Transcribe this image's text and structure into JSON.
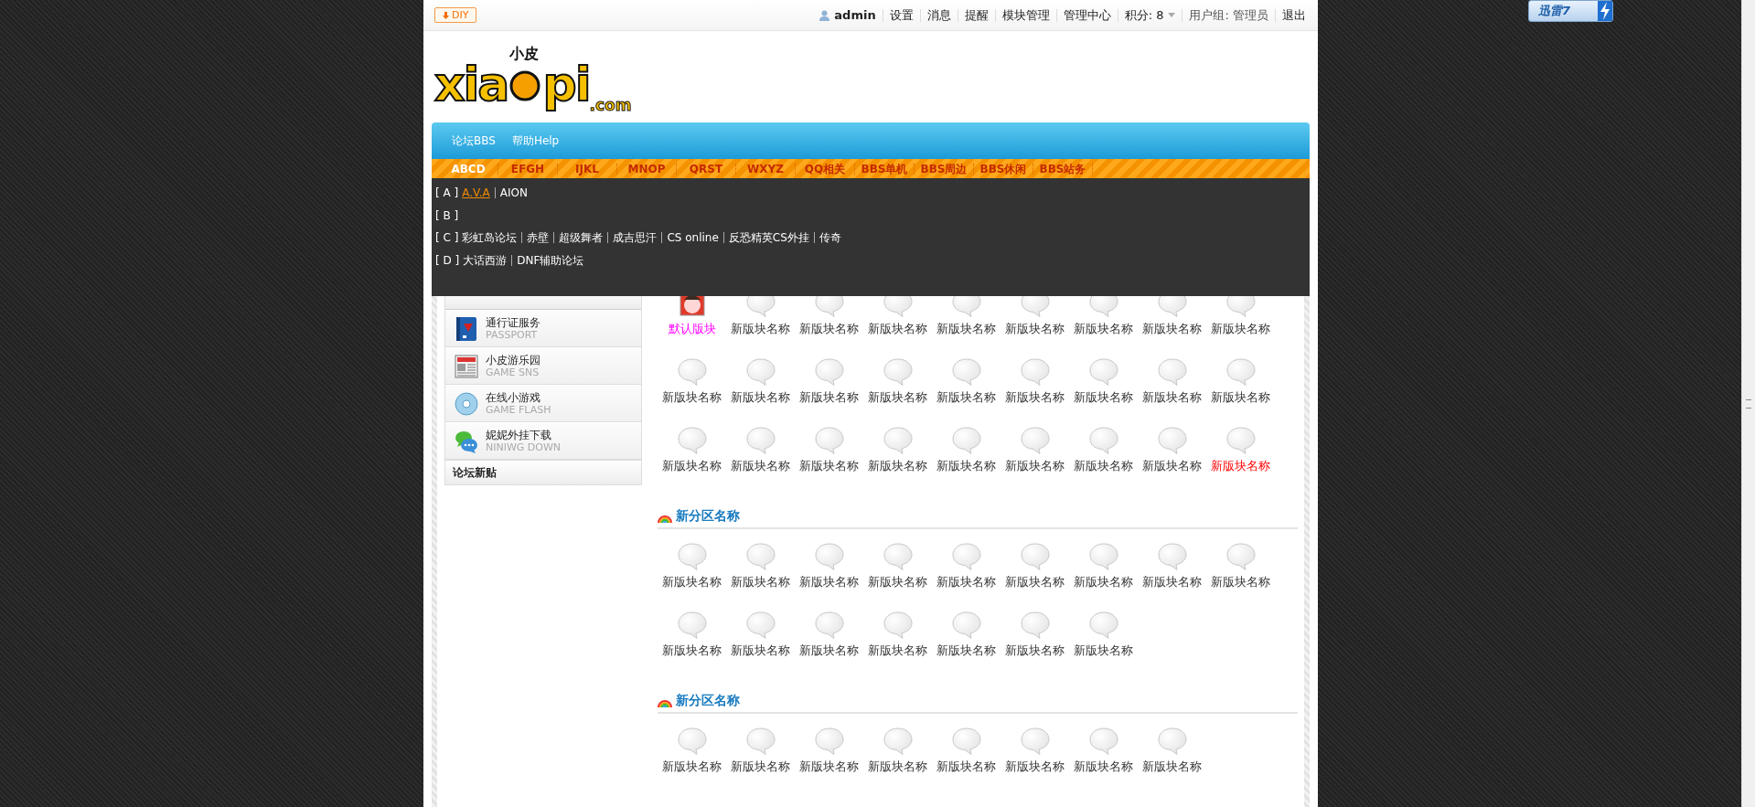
{
  "toolbar": {
    "diy": "DIY",
    "user": "admin",
    "links": [
      "设置",
      "消息",
      "提醒",
      "模块管理",
      "管理中心"
    ],
    "points": "积分: 8",
    "group": "用户组: 管理员",
    "logout": "退出"
  },
  "plugin_button": {
    "label": "迅雷7"
  },
  "logo": {
    "top": "小皮",
    "left": "xia",
    "right": "pi",
    "suffix": ".com"
  },
  "nav": {
    "items": [
      "论坛BBS",
      "帮助Help"
    ]
  },
  "category_tabs": [
    {
      "label": "ABCD",
      "selected": true
    },
    {
      "label": "EFGH",
      "selected": false
    },
    {
      "label": "IJKL",
      "selected": false
    },
    {
      "label": "MNOP",
      "selected": false
    },
    {
      "label": "QRST",
      "selected": false
    },
    {
      "label": "WXYZ",
      "selected": false
    },
    {
      "label": "QQ相关",
      "selected": false
    },
    {
      "label": "BBS单机",
      "selected": false
    },
    {
      "label": "BBS周边",
      "selected": false
    },
    {
      "label": "BBS休闲",
      "selected": false
    },
    {
      "label": "BBS站务",
      "selected": false
    }
  ],
  "dropdown": [
    {
      "letter": "[ A ]",
      "links": [
        {
          "label": "A.V.A",
          "selected": true
        },
        {
          "label": "AION",
          "selected": false
        }
      ]
    },
    {
      "letter": "[ B ]"
    },
    {
      "letter": "[ C ]",
      "links": [
        {
          "label": "彩虹岛论坛",
          "selected": false
        },
        {
          "label": "赤壁",
          "selected": false
        },
        {
          "label": "超级舞者",
          "selected": false
        },
        {
          "label": "成吉思汗",
          "selected": false
        },
        {
          "label": "CS online",
          "selected": false
        },
        {
          "label": "反恐精英CS外挂",
          "selected": false
        },
        {
          "label": "传奇",
          "selected": false
        }
      ]
    },
    {
      "letter": "[ D ]",
      "links": [
        {
          "label": "大话西游",
          "selected": false
        },
        {
          "label": "DNF辅助论坛",
          "selected": false
        }
      ]
    }
  ],
  "sidebar": {
    "items": [
      {
        "kind": "book",
        "title": "通行证服务",
        "subtitle": "PASSPORT"
      },
      {
        "kind": "news",
        "title": "小皮游乐园",
        "subtitle": "GAME SNS"
      },
      {
        "kind": "disc",
        "title": "在线小游戏",
        "subtitle": "GAME FLASH"
      },
      {
        "kind": "chat",
        "title": "妮妮外挂下载",
        "subtitle": "NINIWG DOWN"
      }
    ],
    "footer": "论坛新贴"
  },
  "sections": [
    {
      "forums": [
        {
          "name": "默认版块",
          "kind": "avatar",
          "color": "#ff00ff"
        },
        {
          "name": "新版块名称",
          "kind": "bubble"
        },
        {
          "name": "新版块名称",
          "kind": "bubble"
        },
        {
          "name": "新版块名称",
          "kind": "bubble"
        },
        {
          "name": "新版块名称",
          "kind": "bubble"
        },
        {
          "name": "新版块名称",
          "kind": "bubble"
        },
        {
          "name": "新版块名称",
          "kind": "bubble"
        },
        {
          "name": "新版块名称",
          "kind": "bubble"
        },
        {
          "name": "新版块名称",
          "kind": "bubble"
        },
        {
          "name": "新版块名称",
          "kind": "bubble"
        },
        {
          "name": "新版块名称",
          "kind": "bubble"
        },
        {
          "name": "新版块名称",
          "kind": "bubble"
        },
        {
          "name": "新版块名称",
          "kind": "bubble"
        },
        {
          "name": "新版块名称",
          "kind": "bubble"
        },
        {
          "name": "新版块名称",
          "kind": "bubble"
        },
        {
          "name": "新版块名称",
          "kind": "bubble"
        },
        {
          "name": "新版块名称",
          "kind": "bubble"
        },
        {
          "name": "新版块名称",
          "kind": "bubble"
        },
        {
          "name": "新版块名称",
          "kind": "bubble"
        },
        {
          "name": "新版块名称",
          "kind": "bubble"
        },
        {
          "name": "新版块名称",
          "kind": "bubble"
        },
        {
          "name": "新版块名称",
          "kind": "bubble"
        },
        {
          "name": "新版块名称",
          "kind": "bubble"
        },
        {
          "name": "新版块名称",
          "kind": "bubble"
        },
        {
          "name": "新版块名称",
          "kind": "bubble"
        },
        {
          "name": "新版块名称",
          "kind": "bubble"
        },
        {
          "name": "新版块名称",
          "kind": "bubble",
          "color": "#ff0000"
        }
      ]
    },
    {
      "title": "新分区名称",
      "forums": [
        {
          "name": "新版块名称",
          "kind": "bubble"
        },
        {
          "name": "新版块名称",
          "kind": "bubble"
        },
        {
          "name": "新版块名称",
          "kind": "bubble"
        },
        {
          "name": "新版块名称",
          "kind": "bubble"
        },
        {
          "name": "新版块名称",
          "kind": "bubble"
        },
        {
          "name": "新版块名称",
          "kind": "bubble"
        },
        {
          "name": "新版块名称",
          "kind": "bubble"
        },
        {
          "name": "新版块名称",
          "kind": "bubble"
        },
        {
          "name": "新版块名称",
          "kind": "bubble"
        },
        {
          "name": "新版块名称",
          "kind": "bubble"
        },
        {
          "name": "新版块名称",
          "kind": "bubble"
        },
        {
          "name": "新版块名称",
          "kind": "bubble"
        },
        {
          "name": "新版块名称",
          "kind": "bubble"
        },
        {
          "name": "新版块名称",
          "kind": "bubble"
        },
        {
          "name": "新版块名称",
          "kind": "bubble"
        },
        {
          "name": "新版块名称",
          "kind": "bubble"
        }
      ]
    },
    {
      "title": "新分区名称",
      "forums": [
        {
          "name": "新版块名称",
          "kind": "bubble"
        },
        {
          "name": "新版块名称",
          "kind": "bubble"
        },
        {
          "name": "新版块名称",
          "kind": "bubble"
        },
        {
          "name": "新版块名称",
          "kind": "bubble"
        },
        {
          "name": "新版块名称",
          "kind": "bubble"
        },
        {
          "name": "新版块名称",
          "kind": "bubble"
        },
        {
          "name": "新版块名称",
          "kind": "bubble"
        },
        {
          "name": "新版块名称",
          "kind": "bubble"
        }
      ]
    }
  ]
}
